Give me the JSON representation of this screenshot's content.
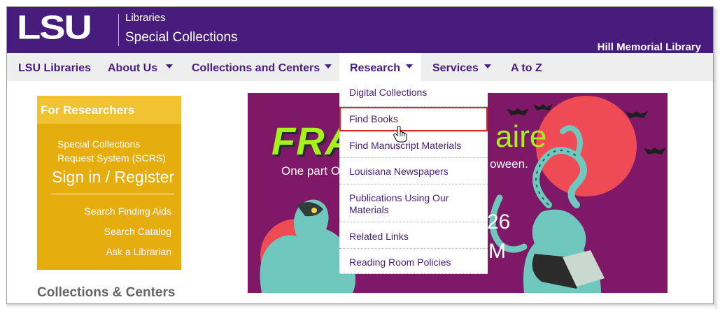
{
  "header": {
    "logo_text": "LSU",
    "libraries": "Libraries",
    "department": "Special Collections",
    "building": "Hill Memorial Library"
  },
  "nav": {
    "items": [
      {
        "label": "LSU Libraries"
      },
      {
        "label": "About Us"
      },
      {
        "label": "Collections and Centers"
      },
      {
        "label": "Research"
      },
      {
        "label": "Services"
      },
      {
        "label": "A to Z"
      }
    ]
  },
  "research_menu": {
    "items": [
      {
        "label": "Digital Collections"
      },
      {
        "label": "Find Books"
      },
      {
        "label": "Find Manuscript Materials"
      },
      {
        "label": "Louisiana Newspapers"
      },
      {
        "label": "Publications Using Our Materials"
      },
      {
        "label": "Related Links"
      },
      {
        "label": "Reading Room Policies"
      }
    ]
  },
  "sidebar": {
    "heading": "For Researchers",
    "scrs_line1": "Special Collections",
    "scrs_line2": "Request System (SCRS)",
    "sign_in": "Sign in / Register",
    "links": [
      {
        "label": "Search Finding Aids"
      },
      {
        "label": "Search Catalog"
      },
      {
        "label": "Ask a Librarian"
      }
    ]
  },
  "section": {
    "collections_heading": "Collections & Centers"
  },
  "banner": {
    "title_left": "FRA",
    "title_right": "aire",
    "subtitle_left": "One part O",
    "subtitle_right": "oween.",
    "date_fragment": "26",
    "time_fragment": "M"
  },
  "colors": {
    "lsu_purple": "#461d7c",
    "sidebar_gold": "#e6ad0e",
    "sidebar_gold_light": "#f1c232",
    "banner_magenta": "#8b1a6b",
    "banner_lime": "#a6f01c",
    "highlight_red": "#d8262c"
  }
}
